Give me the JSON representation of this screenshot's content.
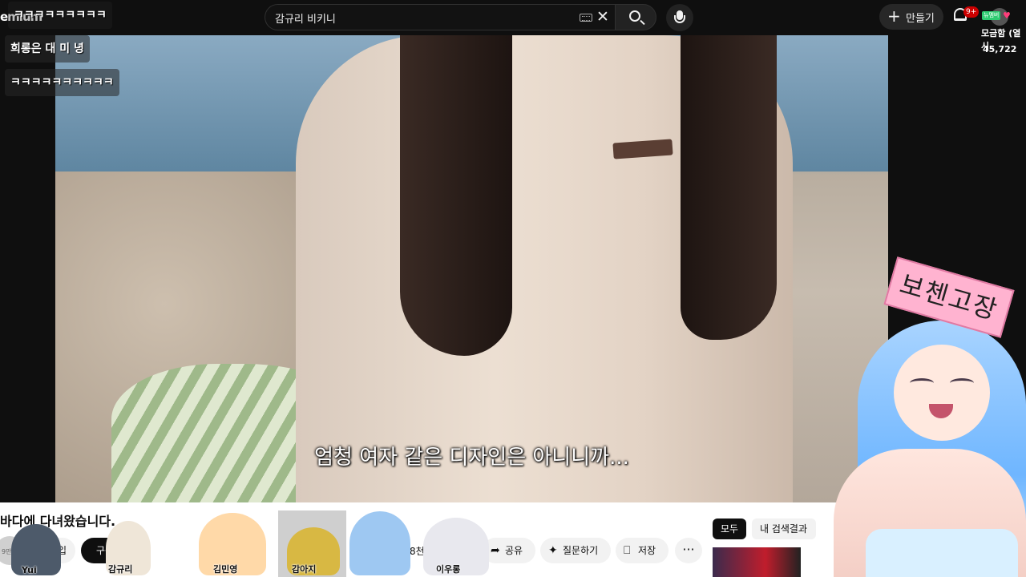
{
  "topbar": {
    "logo_text": "emium",
    "search_value": "감규리 비키니",
    "create_label": "만들기",
    "notification_badge": "9+"
  },
  "chat_overlay": [
    "ㅋㅋㅋㅋㅋㅋㅋㅋㅋ",
    "희롱은 대 미 녕",
    "ㅋㅋㅋㅋㅋㅋㅋㅋㅋㅋ"
  ],
  "side_widget": {
    "badge": "뉴멤버",
    "name": "모금함 (열시",
    "count": "45,722"
  },
  "video": {
    "subtitle": "엄청 여자 같은 디자인은 아니니까..."
  },
  "sign_text": "보첸고장",
  "below_video": {
    "title": "바다에 다녀왔습니다.",
    "subs": "9만명",
    "join_label": "가입",
    "subscribe_label": "구독",
    "like_count": "8천",
    "share_label": "공유",
    "ask_label": "질문하기",
    "save_label": "저장",
    "more_label": "···",
    "chip_all": "모두",
    "chip_mine": "내 검색결과"
  },
  "characters": [
    {
      "label": "Yui",
      "color": "#4d5a6a"
    },
    {
      "label": "감규리",
      "color": "#efe6d8"
    },
    {
      "label": "김민영",
      "color": "#ffd9a8"
    },
    {
      "label": "감아지",
      "color": "#d8b843"
    },
    {
      "label": "",
      "color": "#9ec8f2"
    },
    {
      "label": "이우롱",
      "color": "#e8e8ee"
    }
  ],
  "colors": {
    "bg": "#0f0f0f",
    "accent_red": "#cc0000",
    "sign_pink": "#ffb3d0"
  }
}
